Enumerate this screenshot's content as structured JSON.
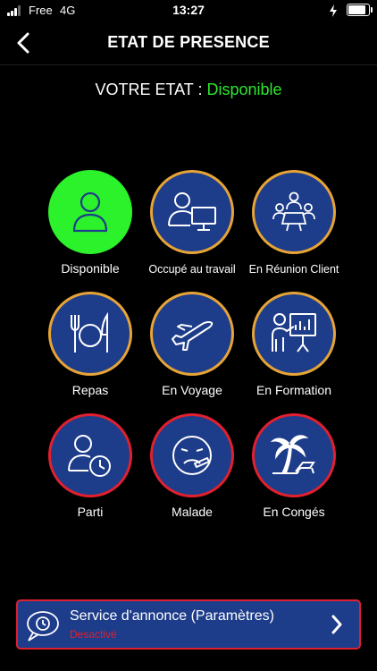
{
  "status_bar": {
    "carrier": "Free",
    "network": "4G",
    "time": "13:27"
  },
  "header": {
    "title": "ETAT DE PRESENCE"
  },
  "state": {
    "label": "VOTRE ETAT :",
    "value": "Disponible",
    "value_color": "#2ee62e"
  },
  "states": [
    {
      "label": "Disponible",
      "icon": "person-icon",
      "active": true
    },
    {
      "label": "Occupé au travail",
      "icon": "person-computer-icon"
    },
    {
      "label": "En Réunion Client",
      "icon": "meeting-icon"
    },
    {
      "label": "Repas",
      "icon": "plate-cutlery-icon"
    },
    {
      "label": "En Voyage",
      "icon": "airplane-icon"
    },
    {
      "label": "En Formation",
      "icon": "presentation-icon"
    },
    {
      "label": "Parti",
      "icon": "person-clock-icon"
    },
    {
      "label": "Malade",
      "icon": "sick-face-icon"
    },
    {
      "label": "En Congés",
      "icon": "palm-tree-icon"
    }
  ],
  "announcement": {
    "title": "Service d'annonce (Paramètres)",
    "status": "Desactivé",
    "icon": "speech-clock-icon"
  },
  "colors": {
    "circle_bg": "#1d3c8a",
    "border_orange": "#e7a436",
    "border_red": "#e0202e",
    "active_green": "#2cf22c"
  }
}
